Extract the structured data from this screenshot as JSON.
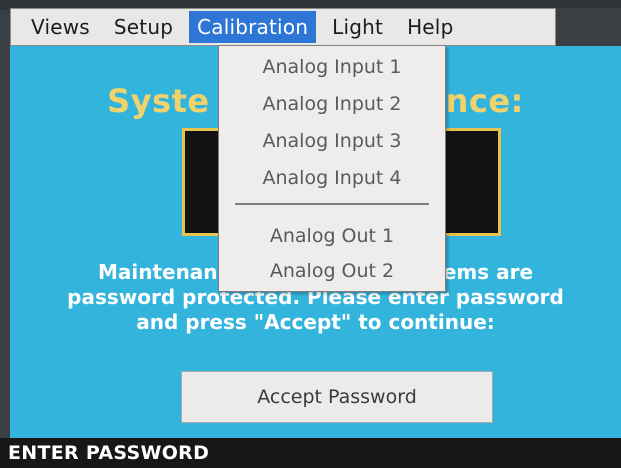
{
  "menubar": {
    "items": [
      {
        "label": "Views"
      },
      {
        "label": "Setup"
      },
      {
        "label": "Calibration",
        "active": true
      },
      {
        "label": "Light"
      },
      {
        "label": "Help"
      }
    ]
  },
  "dropdown": {
    "items": [
      {
        "label": "Analog Input 1"
      },
      {
        "label": "Analog Input 2"
      },
      {
        "label": "Analog Input 3"
      },
      {
        "label": "Analog Input 4"
      },
      {
        "label": "Analog Out 1"
      },
      {
        "label": "Analog Out 2"
      }
    ]
  },
  "main": {
    "heading_left": "Syste",
    "heading_right": "nce:",
    "message_lines": [
      "Maintenan                              items are",
      "password protected.  Please enter password",
      "and press \"Accept\" to continue:"
    ],
    "accept_button": "Accept Password"
  },
  "status": {
    "text": "ENTER PASSWORD"
  },
  "colors": {
    "screen_bg": "#33b4dc",
    "heading": "#f2d36b",
    "menu_highlight": "#2d76d6",
    "box_border": "#e6c34d"
  }
}
